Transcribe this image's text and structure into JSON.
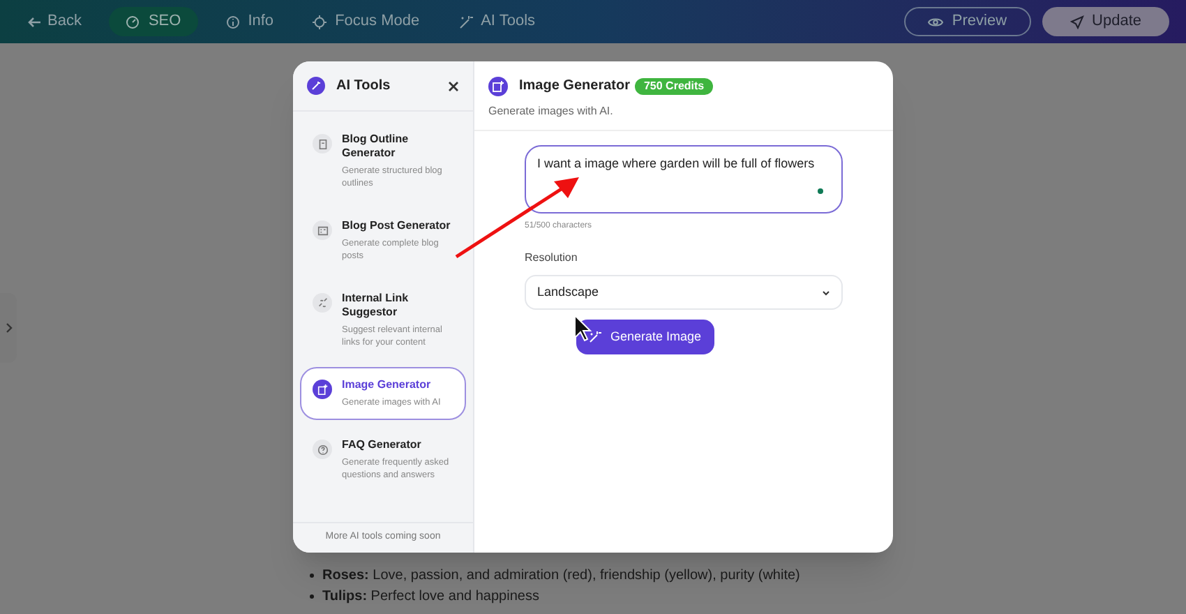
{
  "topbar": {
    "back": "Back",
    "tabs": [
      {
        "label": "SEO",
        "selected": true
      },
      {
        "label": "Info",
        "selected": false
      },
      {
        "label": "Focus Mode",
        "selected": false
      },
      {
        "label": "AI Tools",
        "selected": false
      }
    ],
    "preview": "Preview",
    "update": "Update"
  },
  "modal": {
    "sidebar": {
      "title": "AI Tools",
      "tools": [
        {
          "title": "Blog Outline Generator",
          "description": "Generate structured blog outlines",
          "selected": false
        },
        {
          "title": "Blog Post Generator",
          "description": "Generate complete blog posts",
          "selected": false
        },
        {
          "title": "Internal Link Suggestor",
          "description": "Suggest relevant internal links for your content",
          "selected": false
        },
        {
          "title": "Image Generator",
          "description": "Generate images with AI",
          "selected": true
        },
        {
          "title": "FAQ Generator",
          "description": "Generate frequently asked questions and answers",
          "selected": false
        }
      ],
      "footer": "More AI tools coming soon"
    },
    "main": {
      "title": "Image Generator",
      "credits": "750 Credits",
      "subtitle": "Generate images with AI.",
      "prompt": "I want a image where garden will be full of flowers",
      "char_count": "51/500 characters",
      "resolution_label": "Resolution",
      "resolution": "Landscape",
      "generate": "Generate Image"
    }
  },
  "page": {
    "bullets": [
      "**Roses:** Love, passion, and admiration (red), friendship (yellow), purity (white)",
      "**Tulips:** Perfect love and happiness"
    ]
  }
}
